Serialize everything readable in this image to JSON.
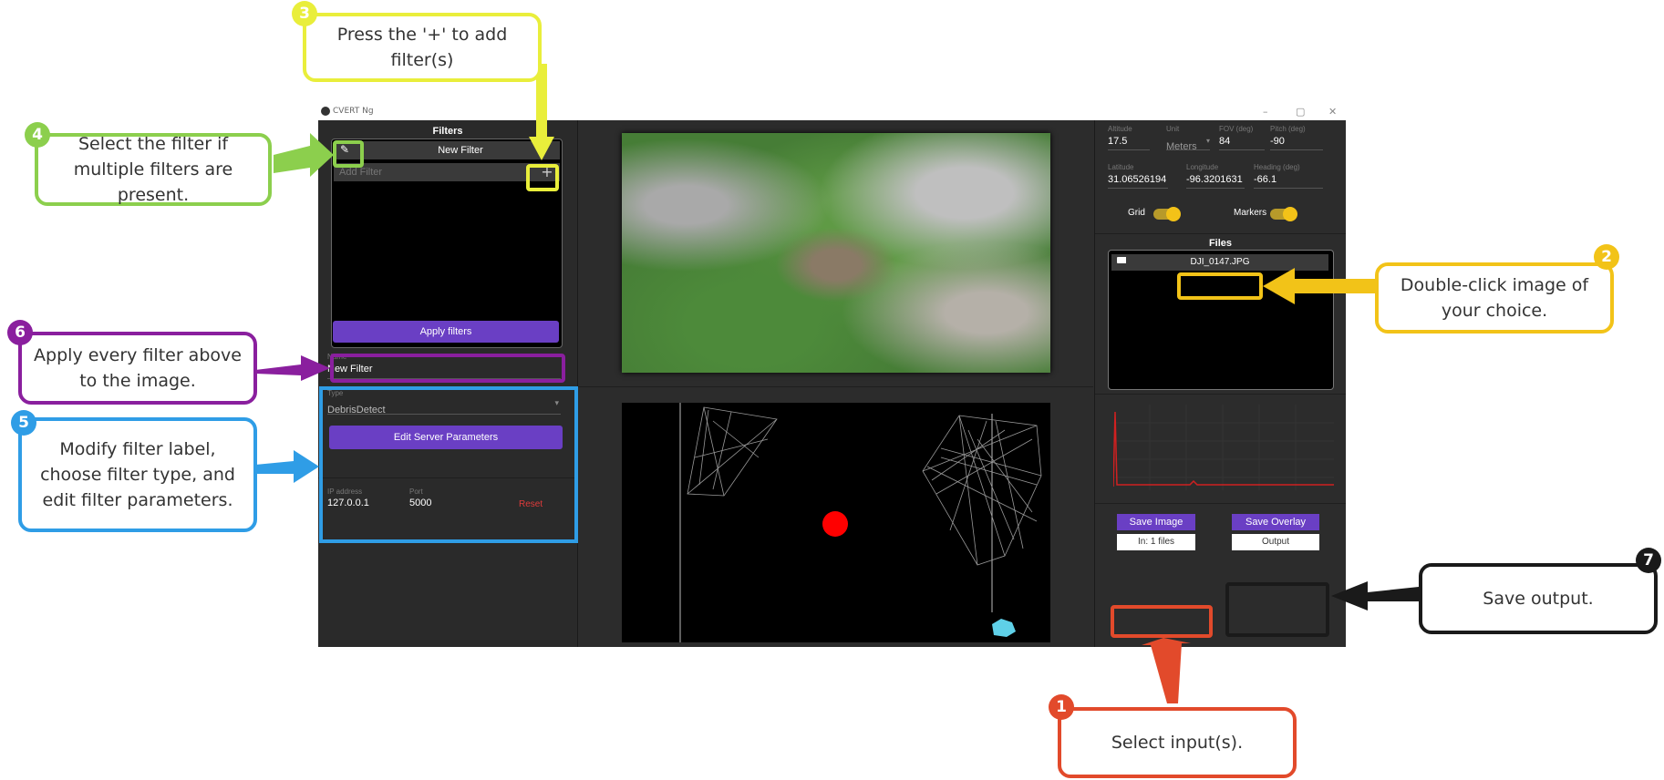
{
  "window": {
    "title": "CVERT Ng",
    "minimize": "–",
    "maximize": "▢",
    "close": "✕"
  },
  "filters": {
    "title": "Filters",
    "new_filter_label": "New Filter",
    "add_placeholder": "Add Filter",
    "add_button": "+",
    "apply_label": "Apply filters"
  },
  "editor": {
    "name_label": "Name",
    "name_value": "New Filter",
    "type_label": "Type",
    "type_value": "DebrisDetect",
    "edit_params_label": "Edit Server Parameters"
  },
  "server": {
    "ip_label": "IP address",
    "ip_value": "127.0.0.1",
    "port_label": "Port",
    "port_value": "5000",
    "reset_label": "Reset"
  },
  "camera": {
    "altitude_label": "Altitude",
    "altitude_value": "17.5",
    "unit_label": "Unit",
    "unit_value": "Meters",
    "fov_label": "FOV (deg)",
    "fov_value": "84",
    "pitch_label": "Pitch (deg)",
    "pitch_value": "-90",
    "lat_label": "Latitude",
    "lat_value": "31.06526194",
    "lon_label": "Longitude",
    "lon_value": "-96.3201631",
    "heading_label": "Heading (deg)",
    "heading_value": "-66.1",
    "grid_label": "Grid",
    "markers_label": "Markers",
    "grid_on": true,
    "markers_on": true
  },
  "files": {
    "title": "Files",
    "items": [
      "DJI_0147.JPG"
    ]
  },
  "output": {
    "save_image": "Save Image",
    "input_label": "In: 1 files",
    "save_overlay": "Save Overlay",
    "output_label": "Output"
  },
  "callouts": {
    "c1": "Select input(s).",
    "c2": "Double-click image of your choice.",
    "c3": "Press the '+' to add filter(s)",
    "c4": "Select the filter if multiple filters are present.",
    "c5": "Modify filter label, choose filter type, and edit filter parameters.",
    "c6": "Apply every filter above to the image.",
    "c7": "Save output."
  },
  "badges": {
    "b1": "1",
    "b2": "2",
    "b3": "3",
    "b4": "4",
    "b5": "5",
    "b6": "6",
    "b7": "7"
  },
  "colors": {
    "c1": "#e24a2b",
    "c2": "#f2c318",
    "c3": "#e9ee3b",
    "c4": "#8ccf4d",
    "c5": "#2f9de6",
    "c6": "#8a1f9e",
    "c7": "#1a1a1a",
    "accent": "#6a3fc4"
  }
}
